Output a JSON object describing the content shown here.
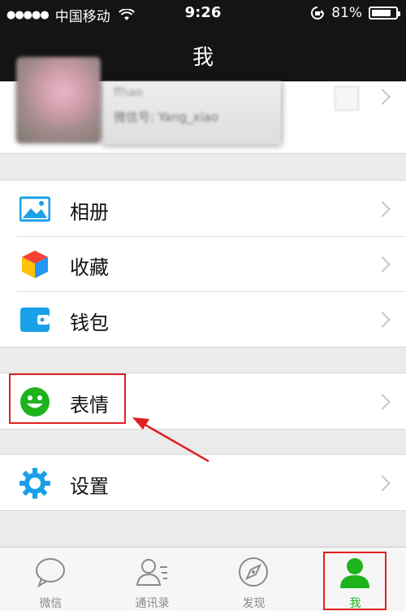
{
  "status_bar": {
    "signal_dots": "●●●●●",
    "carrier": "中国移动",
    "time": "9:26",
    "battery_percent": "81%",
    "battery_level": 0.81
  },
  "nav": {
    "title": "我"
  },
  "profile": {
    "name": "ffhao",
    "id_line": "微信号: Yang_xiao"
  },
  "menu": {
    "album": "相册",
    "favorites": "收藏",
    "wallet": "钱包",
    "stickers": "表情",
    "settings": "设置"
  },
  "tabs": [
    {
      "label": "微信"
    },
    {
      "label": "通讯录"
    },
    {
      "label": "发现"
    },
    {
      "label": "我"
    }
  ],
  "colors": {
    "active_green": "#1db31d",
    "icon_blue": "#1aa0e8",
    "annotation_red": "#e02020"
  }
}
